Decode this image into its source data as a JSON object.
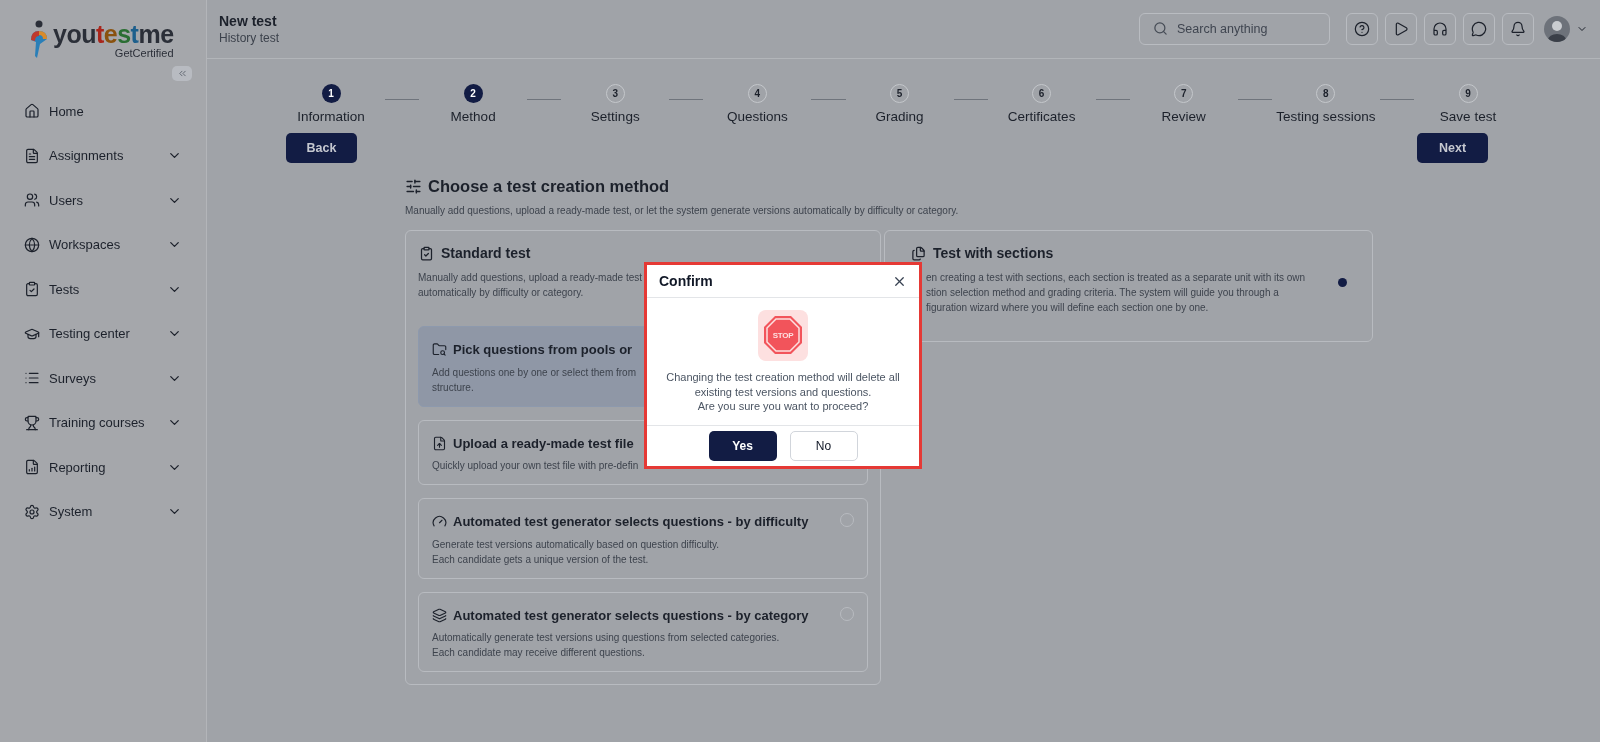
{
  "logo": {
    "parts": [
      {
        "text": "you",
        "color": "#2b2f38"
      },
      {
        "text": "t",
        "color": "#a8261c"
      },
      {
        "text": "e",
        "color": "#8a520e"
      },
      {
        "text": "s",
        "color": "#2a6e33"
      },
      {
        "text": "t",
        "color": "#1d5f8c"
      },
      {
        "text": "me",
        "color": "#2b2f38"
      }
    ],
    "tagline": "GetCertified"
  },
  "sidebar": {
    "items": [
      {
        "label": "Home",
        "expandable": false
      },
      {
        "label": "Assignments",
        "expandable": true
      },
      {
        "label": "Users",
        "expandable": true
      },
      {
        "label": "Workspaces",
        "expandable": true
      },
      {
        "label": "Tests",
        "expandable": true
      },
      {
        "label": "Testing center",
        "expandable": true
      },
      {
        "label": "Surveys",
        "expandable": true
      },
      {
        "label": "Training courses",
        "expandable": true
      },
      {
        "label": "Reporting",
        "expandable": true
      },
      {
        "label": "System",
        "expandable": true
      }
    ]
  },
  "header": {
    "title": "New test",
    "subtitle": "History test",
    "search": {
      "placeholder": "Search anything"
    }
  },
  "stepper": [
    {
      "number": "1",
      "label": "Information",
      "completed": true
    },
    {
      "number": "2",
      "label": "Method",
      "completed": true
    },
    {
      "number": "3",
      "label": "Settings",
      "completed": false
    },
    {
      "number": "4",
      "label": "Questions",
      "completed": false
    },
    {
      "number": "5",
      "label": "Grading",
      "completed": false
    },
    {
      "number": "6",
      "label": "Certificates",
      "completed": false
    },
    {
      "number": "7",
      "label": "Review",
      "completed": false
    },
    {
      "number": "8",
      "label": "Testing sessions",
      "completed": false
    },
    {
      "number": "9",
      "label": "Save test",
      "completed": false
    }
  ],
  "nav_buttons": {
    "back": "Back",
    "next": "Next"
  },
  "section": {
    "title": "Choose a test creation method",
    "description": "Manually add questions, upload a ready-made test, or let the system generate versions automatically by difficulty or category."
  },
  "standard_card": {
    "title": "Standard test",
    "description_lines": [
      "Manually add questions, upload a ready-made test",
      "automatically by difficulty or category."
    ],
    "options": [
      {
        "title": "Pick questions from pools or",
        "lines": [
          "Add questions one by one or select them from",
          "structure."
        ],
        "selected": true
      },
      {
        "title": "Upload a ready-made test file",
        "lines": [
          "Quickly upload your own test file with pre-defin"
        ],
        "selected": false
      },
      {
        "title": "Automated test generator selects questions - by difficulty",
        "lines": [
          "Generate test versions automatically based on question difficulty.",
          "Each candidate gets a unique version of the test."
        ],
        "selected": false,
        "radio": true
      },
      {
        "title": "Automated test generator selects questions - by category",
        "lines": [
          "Automatically generate test versions using questions from selected categories.",
          "Each candidate may receive different questions."
        ],
        "selected": false,
        "radio": true
      }
    ]
  },
  "sections_card": {
    "title": "Test with sections",
    "description_lines": [
      "en creating a test with sections, each section is treated as a separate unit with its own",
      "stion selection method and grading criteria. The system will guide you through a",
      "figuration wizard where you will define each section one by one."
    ],
    "selected": true
  },
  "dialog": {
    "title": "Confirm",
    "icon_text": "STOP",
    "message_lines": [
      "Changing the test creation method will delete all",
      "existing test versions and questions.",
      "Are you sure you want to proceed?"
    ],
    "buttons": [
      {
        "label": "Yes",
        "primary": true
      },
      {
        "label": "No",
        "primary": false
      }
    ]
  }
}
